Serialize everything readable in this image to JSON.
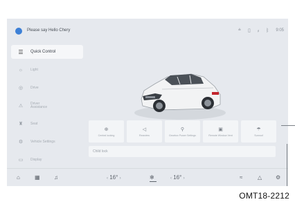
{
  "topbar": {
    "greeting": "Please say Hello Chery",
    "status_icons": [
      "wifi-icon",
      "phone-icon",
      "signal-icon",
      "bluetooth-icon"
    ],
    "status_glyphs": [
      "⩮",
      "▯",
      "ᵢₗ",
      "ᛒ"
    ],
    "time": "9:05"
  },
  "sidebar": {
    "items": [
      {
        "label": "Quick Control",
        "icon": "settings-sliders-icon",
        "glyph": "☰",
        "active": true
      },
      {
        "label": "Light",
        "icon": "light-icon",
        "glyph": "☼",
        "active": false
      },
      {
        "label": "Drive",
        "icon": "steering-wheel-icon",
        "glyph": "◎",
        "active": false
      },
      {
        "label": "Driver Assistance",
        "icon": "driver-assist-icon",
        "glyph": "⚠",
        "active": false
      },
      {
        "label": "Seat",
        "icon": "seat-icon",
        "glyph": "♜",
        "active": false
      },
      {
        "label": "Vehicle Settings",
        "icon": "vehicle-settings-icon",
        "glyph": "⚙",
        "active": false
      },
      {
        "label": "Display",
        "icon": "display-icon",
        "glyph": "▭",
        "active": false
      }
    ]
  },
  "tiles": [
    {
      "label": "Central locking",
      "icon": "lock-icon",
      "glyph": "⊕"
    },
    {
      "label": "Rearview",
      "icon": "mirror-icon",
      "glyph": "◁"
    },
    {
      "label": "Gearbox Power Settings",
      "icon": "gearbox-icon",
      "glyph": "⚲"
    },
    {
      "label": "Remote Window Vent",
      "icon": "window-icon",
      "glyph": "▣"
    },
    {
      "label": "Sunroof",
      "icon": "sunroof-icon",
      "glyph": "☂"
    }
  ],
  "infostrip": {
    "text": "Child lock"
  },
  "bottombar": {
    "home_glyph": "⌂",
    "grid_glyph": "▦",
    "music_glyph": "♫",
    "temp_left": "16°",
    "fan_glyph": "✻",
    "temp_right": "16°",
    "seat_heat_glyph": "≈",
    "warning_glyph": "△",
    "settings_glyph": "⚙"
  },
  "caption": "OMT18-2212"
}
